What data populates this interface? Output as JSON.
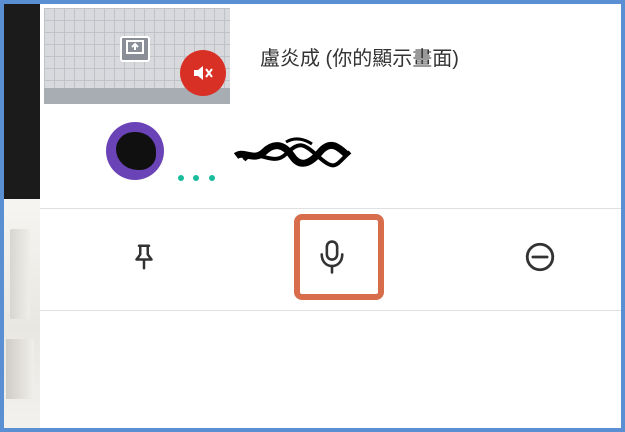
{
  "participants": [
    {
      "name": "盧炎成 (你的顯示畫面)",
      "status": "muted",
      "presenting": true
    },
    {
      "name_redacted": true,
      "speaking_indicator": "..."
    }
  ],
  "actions": [
    {
      "name": "pin",
      "icon": "pin-icon"
    },
    {
      "name": "mic",
      "icon": "microphone-icon"
    },
    {
      "name": "remove",
      "icon": "minus-circle-icon"
    }
  ],
  "colors": {
    "frame_border": "#5b8fd4",
    "mute_red": "#d93025",
    "avatar_purple": "#6a44b6",
    "speaking_dots": "#1abc9c",
    "highlight_box": "#d86d4c"
  }
}
